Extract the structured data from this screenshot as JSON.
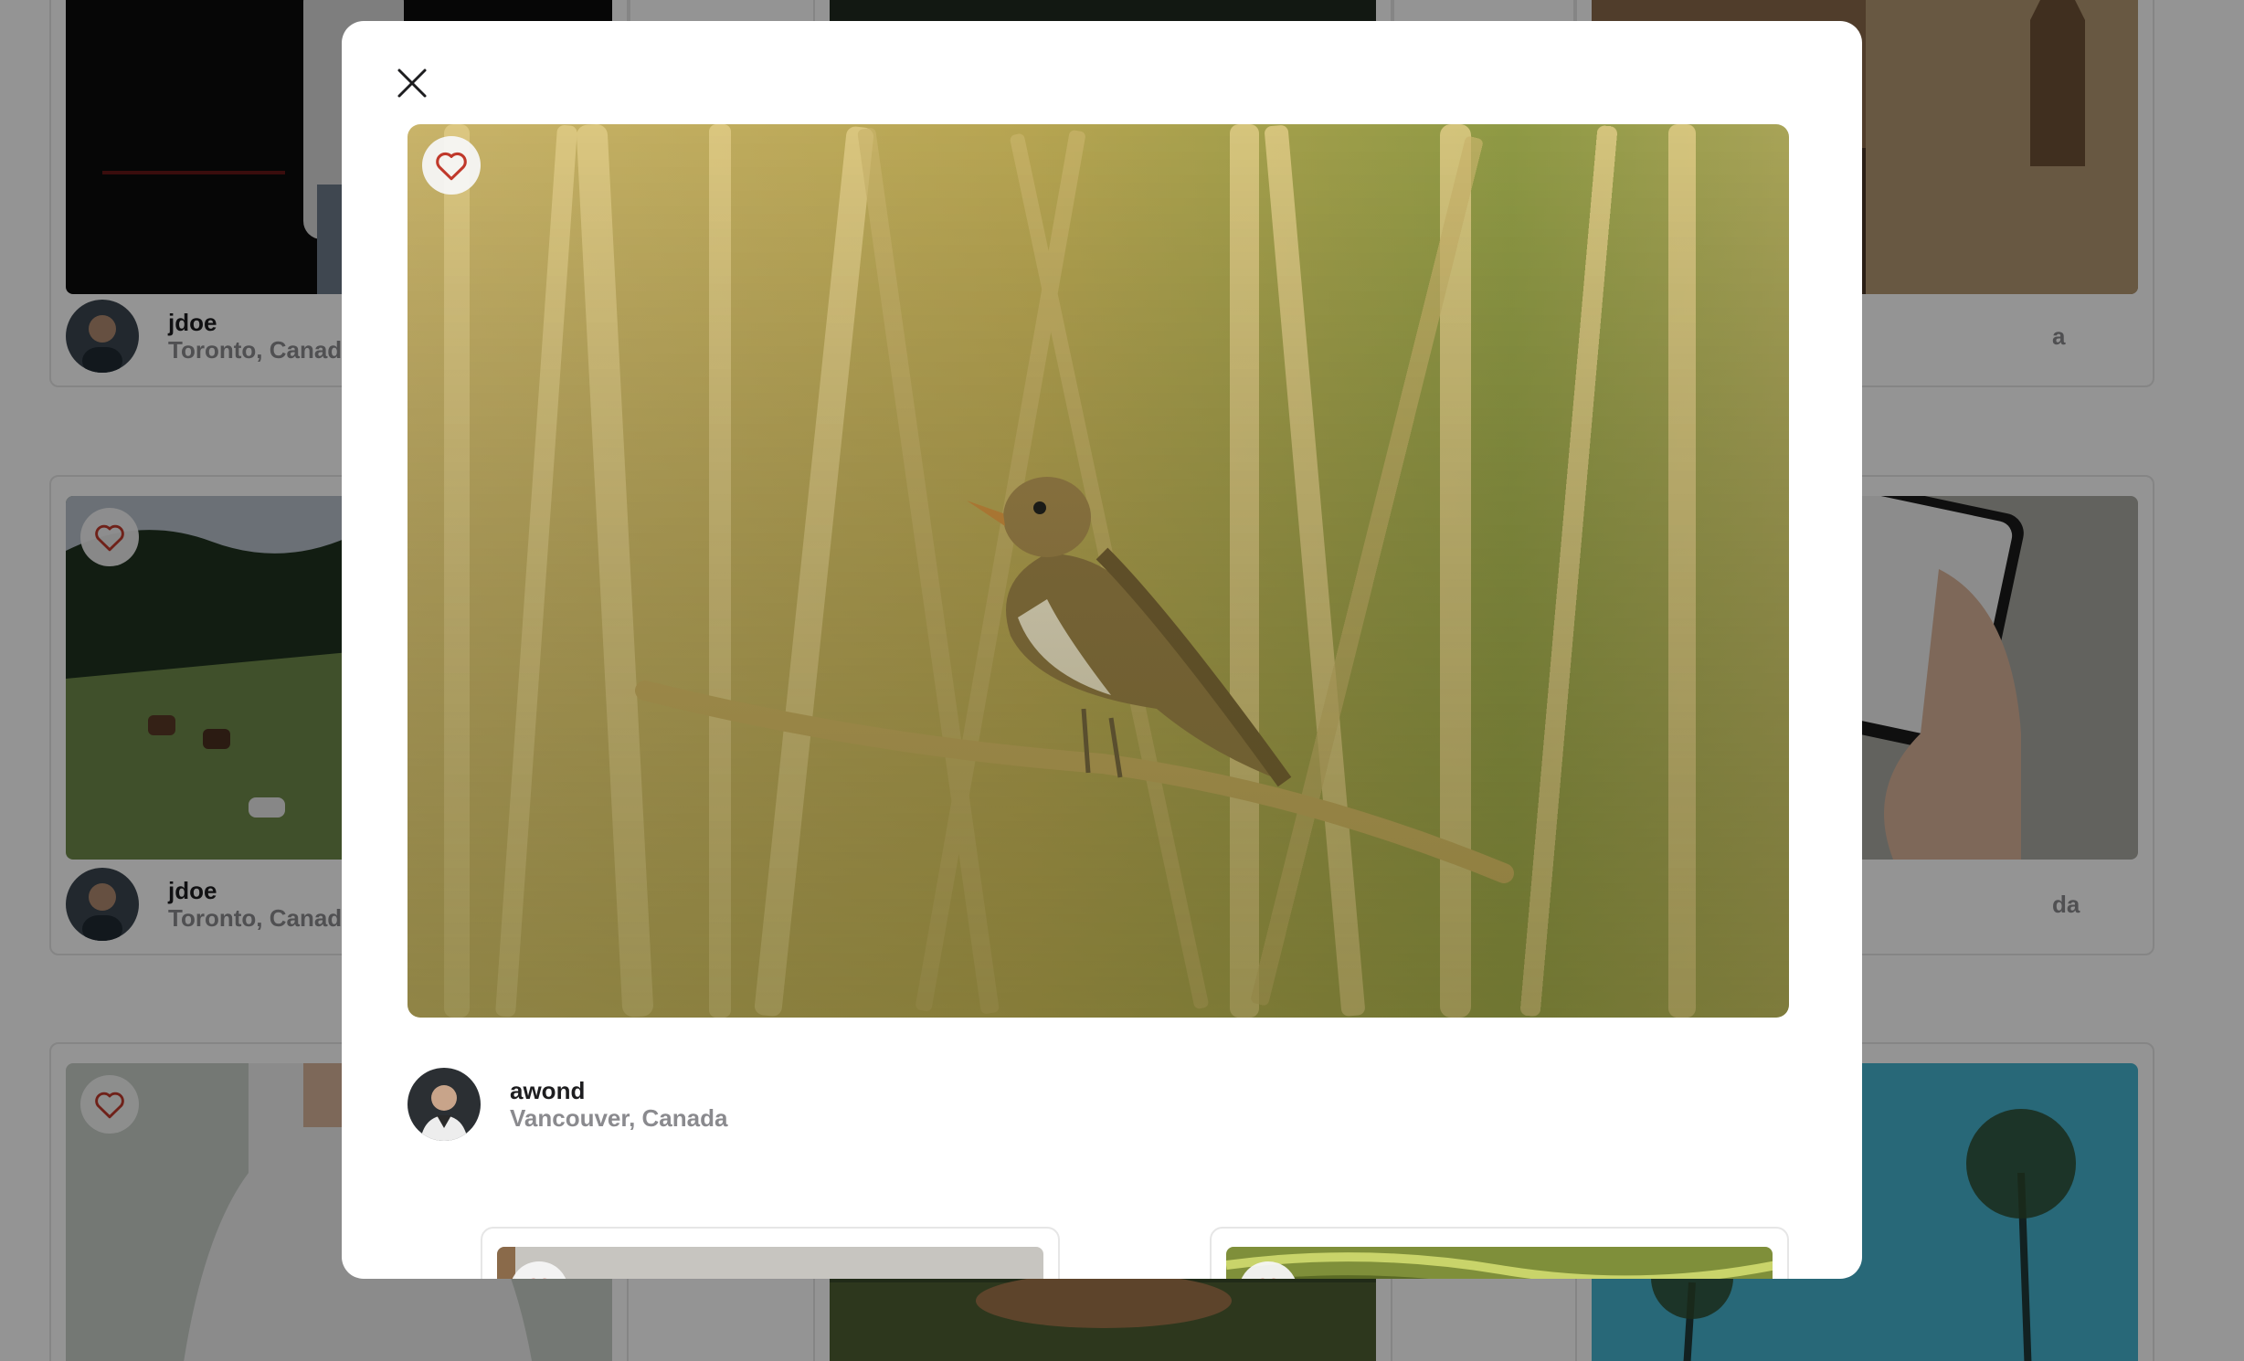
{
  "feed": {
    "cards": [
      {
        "username": "jdoe",
        "location": "Toronto, Canada"
      },
      {
        "username": "",
        "location": "a"
      },
      {
        "username": "jdoe",
        "location": "Toronto, Canada"
      },
      {
        "username": "",
        "location": "da"
      }
    ]
  },
  "modal": {
    "author": {
      "username": "awond",
      "location": "Vancouver, Canada"
    },
    "icons": {
      "close": "close-icon",
      "like": "heart-icon"
    }
  },
  "colors": {
    "heart": "#c0392b",
    "overlay": "rgba(0,0,0,0.42)",
    "card_border": "#e6e6e6",
    "muted_text": "#8a8a8e"
  }
}
